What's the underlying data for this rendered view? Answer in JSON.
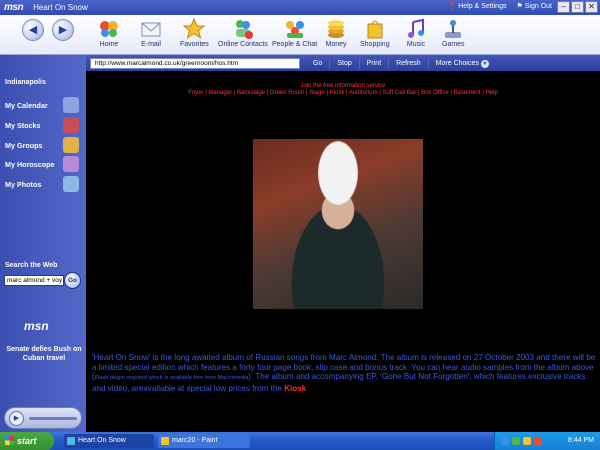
{
  "window": {
    "logo": "msn",
    "title": "Heart On Snow",
    "help_label": "Help & Settings",
    "signout_label": "Sign Out",
    "controls": [
      "–",
      "□",
      "✕"
    ]
  },
  "toolbar": {
    "back_icon": "back-arrow-icon",
    "forward_icon": "forward-arrow-icon",
    "items": [
      {
        "label": "Home",
        "icon": "butterfly-icon"
      },
      {
        "label": "E-mail",
        "icon": "envelope-icon"
      },
      {
        "label": "Favorites",
        "icon": "star-icon"
      },
      {
        "label": "Online Contacts",
        "icon": "contacts-icon"
      },
      {
        "label": "People & Chat",
        "icon": "people-icon"
      },
      {
        "label": "Money",
        "icon": "coins-icon"
      },
      {
        "label": "Shopping",
        "icon": "shopping-bag-icon"
      },
      {
        "label": "Music",
        "icon": "music-note-icon"
      },
      {
        "label": "Games",
        "icon": "joystick-icon"
      }
    ]
  },
  "address": {
    "url": "http://www.marcalmond.co.uk/greenroom/hos.htm",
    "go": "Go",
    "stop": "Stop",
    "print": "Print",
    "refresh": "Refresh",
    "more": "More Choices"
  },
  "sidebar": {
    "city": "Indianapolis",
    "items": [
      {
        "label": "My Calendar",
        "color": "#8fa3e0"
      },
      {
        "label": "My Stocks",
        "color": "#c94d58"
      },
      {
        "label": "My Groups",
        "color": "#e0b24a"
      },
      {
        "label": "My Horoscope",
        "color": "#b68ad6"
      },
      {
        "label": "My Photos",
        "color": "#8fb8e0"
      }
    ],
    "search_label": "Search the Web",
    "search_value": "marc almond + voy",
    "search_go": "Go",
    "msn_logo": "msn",
    "news": "Senate defies Bush on Cuban travel"
  },
  "page": {
    "join": "Join the free information service",
    "nav_links": "Foyer | Manager | Backstage | Green Room | Stage | Kiosk | Auditorium | Soft Cell Bar | Box Office | Basement | Help",
    "desc_1": "'Heart On Snow' is the long awaited album of Russian songs from Marc Almond. The album is released on 27 October 2003 and there will be a limited special edition which features a forty four page book, slip case and bonus track. You can hear audio samples from the album above (",
    "desc_small": "Flash plugin required which is available free from Macromedia",
    "desc_2": "). The album and accompanying EP, 'Gone But Not Forgotten', which features exclusive tracks and video, areavailable at special low prices from the ",
    "kiosk": "Kiosk"
  },
  "taskbar": {
    "start": "start",
    "tasks": [
      "Heart On Snow",
      "marc20 - Paint"
    ],
    "clock": "8:44 PM"
  },
  "colors": {
    "accent": "#2f4bb4",
    "link_red": "#ff3333",
    "desc_blue": "#3a5bd8"
  }
}
